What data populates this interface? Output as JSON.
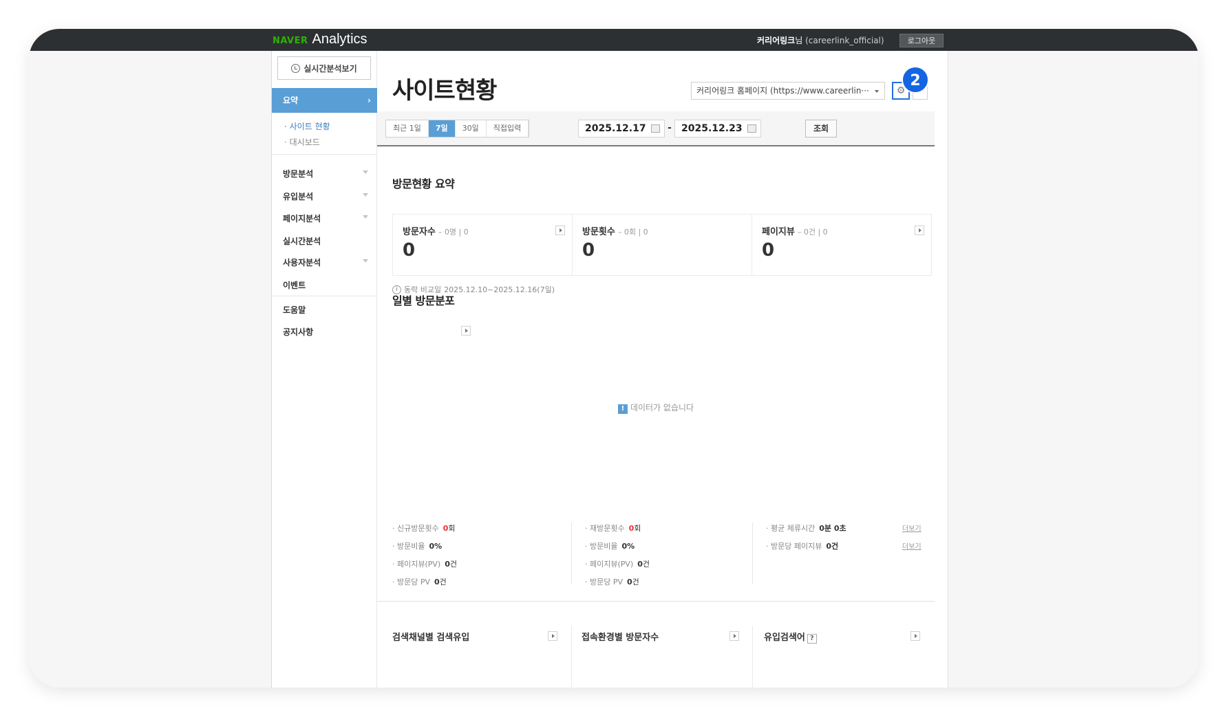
{
  "header": {
    "logo_brand": "NAVER",
    "logo_product": "Analytics",
    "user_name": "커리어링크",
    "user_suffix": "님",
    "user_account": "(careerlink_official)",
    "logout_label": "로그아웃"
  },
  "sidebar": {
    "realtime_button": "실시간분석보기",
    "active_item": "요약",
    "active_arrow": "›",
    "sub_items": [
      "· 사이트 현황",
      "· 대시보드"
    ],
    "items": [
      "방문분석",
      "유입분석",
      "페이지분석",
      "실시간분석",
      "사용자분석",
      "이벤트",
      "도움말",
      "공지사항"
    ]
  },
  "main": {
    "page_title": "사이트현황",
    "site_selector": "커리어링크 홈페이지 (https://www.careerlin···",
    "settings_icon_glyph": "⚙",
    "annotation_badge": "2",
    "period_tabs": [
      "최근 1일",
      "7일",
      "30일",
      "직접입력"
    ],
    "period_selected": "7일",
    "date_from": "2025.12.17",
    "date_separator": "-",
    "date_to": "2025.12.23",
    "query_button": "조회",
    "summary_title": "방문현황 요약",
    "summary_cards": [
      {
        "label": "방문자수",
        "sub": "– 0명 | 0",
        "value": "0"
      },
      {
        "label": "방문횟수",
        "sub": "– 0회 | 0",
        "value": "0"
      },
      {
        "label": "페이지뷰",
        "sub": "– 0건 | 0",
        "value": "0"
      }
    ],
    "compare_info_glyph": "i",
    "compare_label": "동락 비교일",
    "compare_range": "2025.12.10~2025.12.16(7일)",
    "daily_title": "일별 방문분포",
    "no_data_glyph": "!",
    "no_data": "데이터가 없습니다",
    "stats_left": [
      {
        "label": "· 신규방문횟수",
        "value": "0",
        "unit": "회",
        "highlight": true
      },
      {
        "label": "· 방문비율",
        "value": "0%",
        "unit": "",
        "highlight": false
      },
      {
        "label": "· 페이지뷰(PV)",
        "value": "0",
        "unit": "건",
        "highlight": false
      },
      {
        "label": "· 방문당 PV",
        "value": "0",
        "unit": "건",
        "highlight": false
      }
    ],
    "stats_mid": [
      {
        "label": "· 재방문횟수",
        "value": "0",
        "unit": "회",
        "highlight": true
      },
      {
        "label": "· 방문비율",
        "value": "0%",
        "unit": "",
        "highlight": false
      },
      {
        "label": "· 페이지뷰(PV)",
        "value": "0",
        "unit": "건",
        "highlight": false
      },
      {
        "label": "· 방문당 PV",
        "value": "0",
        "unit": "건",
        "highlight": false
      }
    ],
    "stats_right": [
      {
        "label": "· 평균 체류시간",
        "value": "0분 0초",
        "more": "더보기"
      },
      {
        "label": "· 방문당 페이지뷰",
        "value": "0건",
        "more": "더보기"
      }
    ],
    "bottom_sections": [
      "검색채널별 검색유입",
      "접속환경별 방문자수",
      "유입검색어"
    ],
    "help_glyph": "?"
  }
}
